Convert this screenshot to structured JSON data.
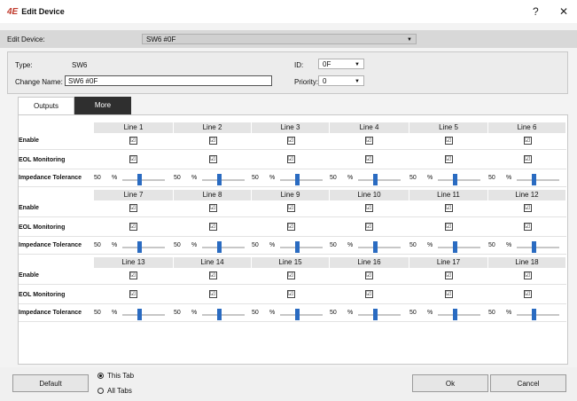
{
  "window": {
    "logo": "4E",
    "title": "Edit Device",
    "help": "?",
    "close": "✕"
  },
  "edit_device": {
    "label": "Edit Device:",
    "value": "SW6 #0F",
    "arrow": "▼"
  },
  "props": {
    "type_label": "Type:",
    "type_value": "SW6",
    "name_label": "Change Name:",
    "name_value": "SW6 #0F",
    "id_label": "ID:",
    "id_value": "0F",
    "priority_label": "Priority:",
    "priority_value": "0",
    "arrow": "▼"
  },
  "tabs": [
    {
      "label": "Outputs"
    },
    {
      "label": "More"
    }
  ],
  "row_labels": {
    "enable": "Enable",
    "eol": "EOL Monitoring",
    "impedance": "Impedance Tolerance"
  },
  "impedance": {
    "value": "50",
    "unit": "%"
  },
  "check": "☑",
  "sections": [
    {
      "lines": [
        "Line 1",
        "Line 2",
        "Line 3",
        "Line 4",
        "Line 5",
        "Line 6"
      ]
    },
    {
      "lines": [
        "Line 7",
        "Line 8",
        "Line 9",
        "Line 10",
        "Line 11",
        "Line 12"
      ]
    },
    {
      "lines": [
        "Line 13",
        "Line 14",
        "Line 15",
        "Line 16",
        "Line 17",
        "Line 18"
      ]
    }
  ],
  "footer": {
    "default": "Default",
    "this_tab": "This Tab",
    "all_tabs": "All Tabs",
    "ok": "Ok",
    "cancel": "Cancel"
  }
}
